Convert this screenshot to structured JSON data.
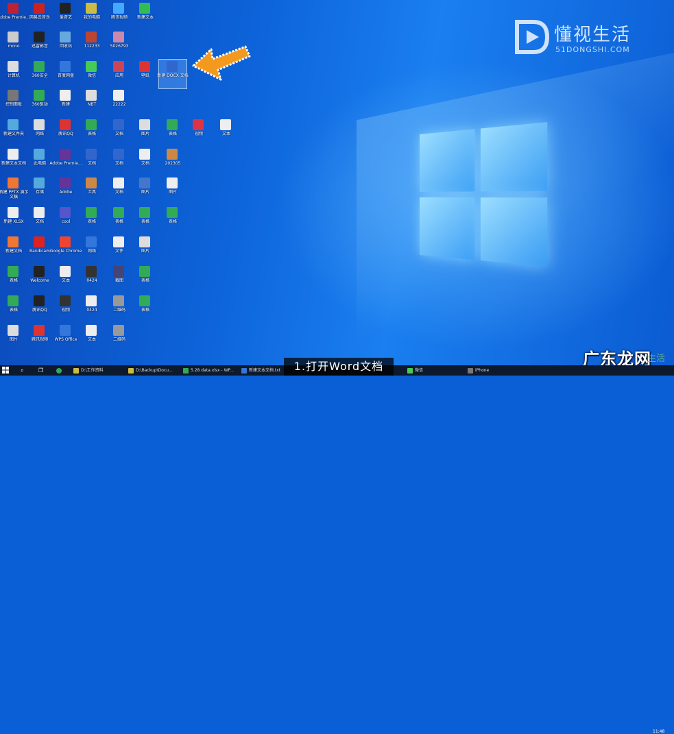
{
  "watermark": {
    "title": "懂视生活",
    "subtitle": "51DONGSHI.COM"
  },
  "caption": "1.打开Word文档",
  "brand": "广东龙网",
  "brand_ghost": "生活",
  "clock": "11:48",
  "icons": [
    {
      "label": "Adobe Premie...",
      "color": "#b23"
    },
    {
      "label": "网易云音乐",
      "color": "#c22"
    },
    {
      "label": "爱奇艺",
      "color": "#222"
    },
    {
      "label": "我的电脑",
      "color": "#cb4"
    },
    {
      "label": "腾讯视频",
      "color": "#4af"
    },
    {
      "label": "新建文本",
      "color": "#3b5"
    },
    {
      "label": "mono",
      "color": "#ccc"
    },
    {
      "label": "迅雷影音",
      "color": "#222"
    },
    {
      "label": "回收站",
      "color": "#6ad"
    },
    {
      "label": "112233",
      "color": "#b43"
    },
    {
      "label": "5026793",
      "color": "#c8a"
    },
    {
      "label": "计算机",
      "color": "#ddd"
    },
    {
      "label": "360安全",
      "color": "#3a5"
    },
    {
      "label": "百度网盘",
      "color": "#37d"
    },
    {
      "label": "微信",
      "color": "#4c5"
    },
    {
      "label": "应用",
      "color": "#c45"
    },
    {
      "label": "壁纸",
      "color": "#d33"
    },
    {
      "label": "新建 DOCX 文档",
      "color": "#36c"
    },
    {
      "label": "控制面板",
      "color": "#777"
    },
    {
      "label": "360驱动",
      "color": "#3a5"
    },
    {
      "label": "新建",
      "color": "#eee"
    },
    {
      "label": "NBT",
      "color": "#ddd"
    },
    {
      "label": "22222",
      "color": "#eee"
    },
    {
      "label": "新建文件夹",
      "color": "#5ad"
    },
    {
      "label": "网络",
      "color": "#ddd"
    },
    {
      "label": "腾讯QQ",
      "color": "#d33"
    },
    {
      "label": "表格",
      "color": "#3a5"
    },
    {
      "label": "文档",
      "color": "#36c"
    },
    {
      "label": "图片",
      "color": "#ddd"
    },
    {
      "label": "表格",
      "color": "#3a5"
    },
    {
      "label": "视频",
      "color": "#d34"
    },
    {
      "label": "文本",
      "color": "#eee"
    },
    {
      "label": "新建文本文档",
      "color": "#eee"
    },
    {
      "label": "此电脑",
      "color": "#5ad"
    },
    {
      "label": "Adobe Premie...",
      "color": "#639"
    },
    {
      "label": "文档",
      "color": "#36c"
    },
    {
      "label": "文档",
      "color": "#36c"
    },
    {
      "label": "文档",
      "color": "#eee"
    },
    {
      "label": "202305",
      "color": "#c84"
    },
    {
      "label": "新建 PPTX 演示文稿",
      "color": "#e73"
    },
    {
      "label": "存储",
      "color": "#5ad"
    },
    {
      "label": "Adobe",
      "color": "#639"
    },
    {
      "label": "工具",
      "color": "#c84"
    },
    {
      "label": "文档",
      "color": "#eee"
    },
    {
      "label": "图片",
      "color": "#47c"
    },
    {
      "label": "图片",
      "color": "#eee"
    },
    {
      "label": "新建 XLSX",
      "color": "#eee"
    },
    {
      "label": "文档",
      "color": "#eee"
    },
    {
      "label": "cool",
      "color": "#55c"
    },
    {
      "label": "表格",
      "color": "#3a5"
    },
    {
      "label": "表格",
      "color": "#3a5"
    },
    {
      "label": "表格",
      "color": "#3a5"
    },
    {
      "label": "表格",
      "color": "#3a5"
    },
    {
      "label": "新建文档",
      "color": "#e73"
    },
    {
      "label": "Bandicam",
      "color": "#d22"
    },
    {
      "label": "Google Chrome",
      "color": "#e43"
    },
    {
      "label": "网络",
      "color": "#37d"
    },
    {
      "label": "文件",
      "color": "#eee"
    },
    {
      "label": "图片",
      "color": "#ddd"
    },
    {
      "label": "表格",
      "color": "#3a5"
    },
    {
      "label": "Welcome",
      "color": "#222"
    },
    {
      "label": "文本",
      "color": "#eee"
    },
    {
      "label": "0424",
      "color": "#333"
    },
    {
      "label": "截图",
      "color": "#447"
    },
    {
      "label": "表格",
      "color": "#3a5"
    },
    {
      "label": "表格",
      "color": "#3a5"
    },
    {
      "label": "腾讯QQ",
      "color": "#222"
    },
    {
      "label": "视频",
      "color": "#333"
    },
    {
      "label": "0424",
      "color": "#eee"
    },
    {
      "label": "二维码",
      "color": "#999"
    },
    {
      "label": "表格",
      "color": "#3a5"
    },
    {
      "label": "图片",
      "color": "#ddd"
    },
    {
      "label": "腾讯视频",
      "color": "#d33"
    },
    {
      "label": "WPS Office",
      "color": "#37d"
    },
    {
      "label": "文本",
      "color": "#eee"
    },
    {
      "label": "二维码",
      "color": "#999"
    },
    {
      "label": "图片",
      "color": "#ddd"
    }
  ],
  "taskbar": {
    "items": [
      {
        "label": "D:\\工作资料",
        "color": "#cb4"
      },
      {
        "label": "D:\\Backup\\Docu...",
        "color": "#cb4"
      },
      {
        "label": "5.28 data.xlsx - WP...",
        "color": "#3a5"
      },
      {
        "label": "新建文本文档.txt",
        "color": "#37d"
      },
      {
        "label": "微信",
        "color": "#4c5"
      },
      {
        "label": "iPhone",
        "color": "#777"
      }
    ]
  }
}
